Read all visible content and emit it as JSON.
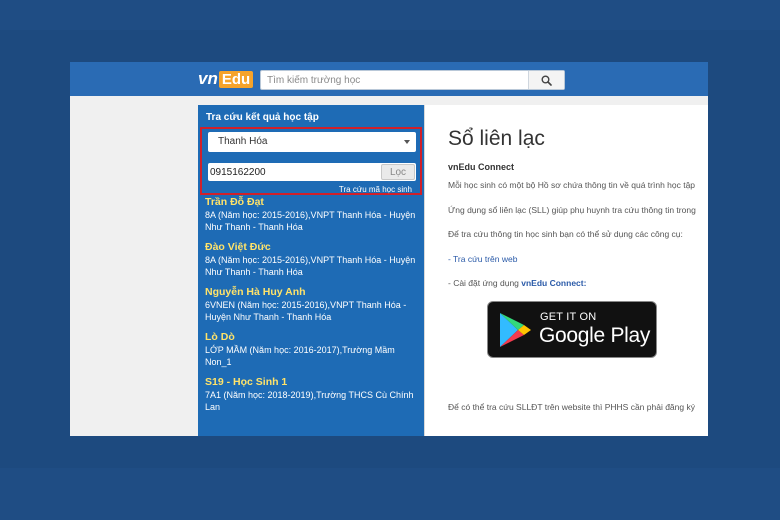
{
  "header": {
    "logo_vn": "vn",
    "logo_edu": "Edu",
    "search_placeholder": "Tìm kiếm trường học"
  },
  "left_panel": {
    "title": "Tra cứu kết quả học tập",
    "province_selected": "Thanh Hóa",
    "phone_value": "0915162200",
    "filter_button": "Lọc",
    "hint_link": "Tra cứu mã học sinh",
    "students": [
      {
        "name": "Trần Đỗ Đạt",
        "info": "8A (Năm học: 2015-2016),VNPT Thanh Hóa - Huyện Như Thanh - Thanh Hóa"
      },
      {
        "name": "Đào Việt Đức",
        "info": "8A (Năm học: 2015-2016),VNPT Thanh Hóa - Huyện Như Thanh - Thanh Hóa"
      },
      {
        "name": "Nguyễn Hà Huy Anh",
        "info": "6VNEN (Năm học: 2015-2016),VNPT Thanh Hóa - Huyện Như Thanh - Thanh Hóa"
      },
      {
        "name": "Lò Dò",
        "info": "LỚP MẦM (Năm học: 2016-2017),Trường Mầm Non_1"
      },
      {
        "name": "S19 - Học Sinh 1",
        "info": "7A1 (Năm học: 2018-2019),Trường THCS Cù Chính Lan"
      }
    ]
  },
  "main": {
    "title": "Sổ liên lạc",
    "subtitle": "vnEdu Connect",
    "p1": "Mỗi học sinh có một bộ Hồ sơ chứa thông tin về quá trình học tập",
    "p2": "Ứng dụng sổ liên lạc (SLL) giúp phụ huynh tra cứu thông tin trong",
    "p3": "Để tra cứu thông tin học sinh bạn có thể sử dụng các công cụ:",
    "link_web": "- Tra cứu trên web",
    "install_prefix": "- Cài đặt ứng dụng ",
    "install_app": "vnEdu Connect:",
    "gplay_small": "GET IT ON",
    "gplay_big": "Google Play",
    "p_bottom": "Để có thể tra cứu SLLĐT trên website thì PHHS cần phải đăng ký"
  },
  "colors": {
    "background": "#1d4a7f",
    "header_bar": "#2a6bb4",
    "left_panel": "#1e6bb5",
    "student_name": "#ffe36a",
    "highlight_box": "#d0202a",
    "arrow": "#e0211f"
  },
  "icons": [
    "search-icon",
    "dropdown-caret-icon",
    "google-play-icon",
    "red-arrow-icon"
  ]
}
